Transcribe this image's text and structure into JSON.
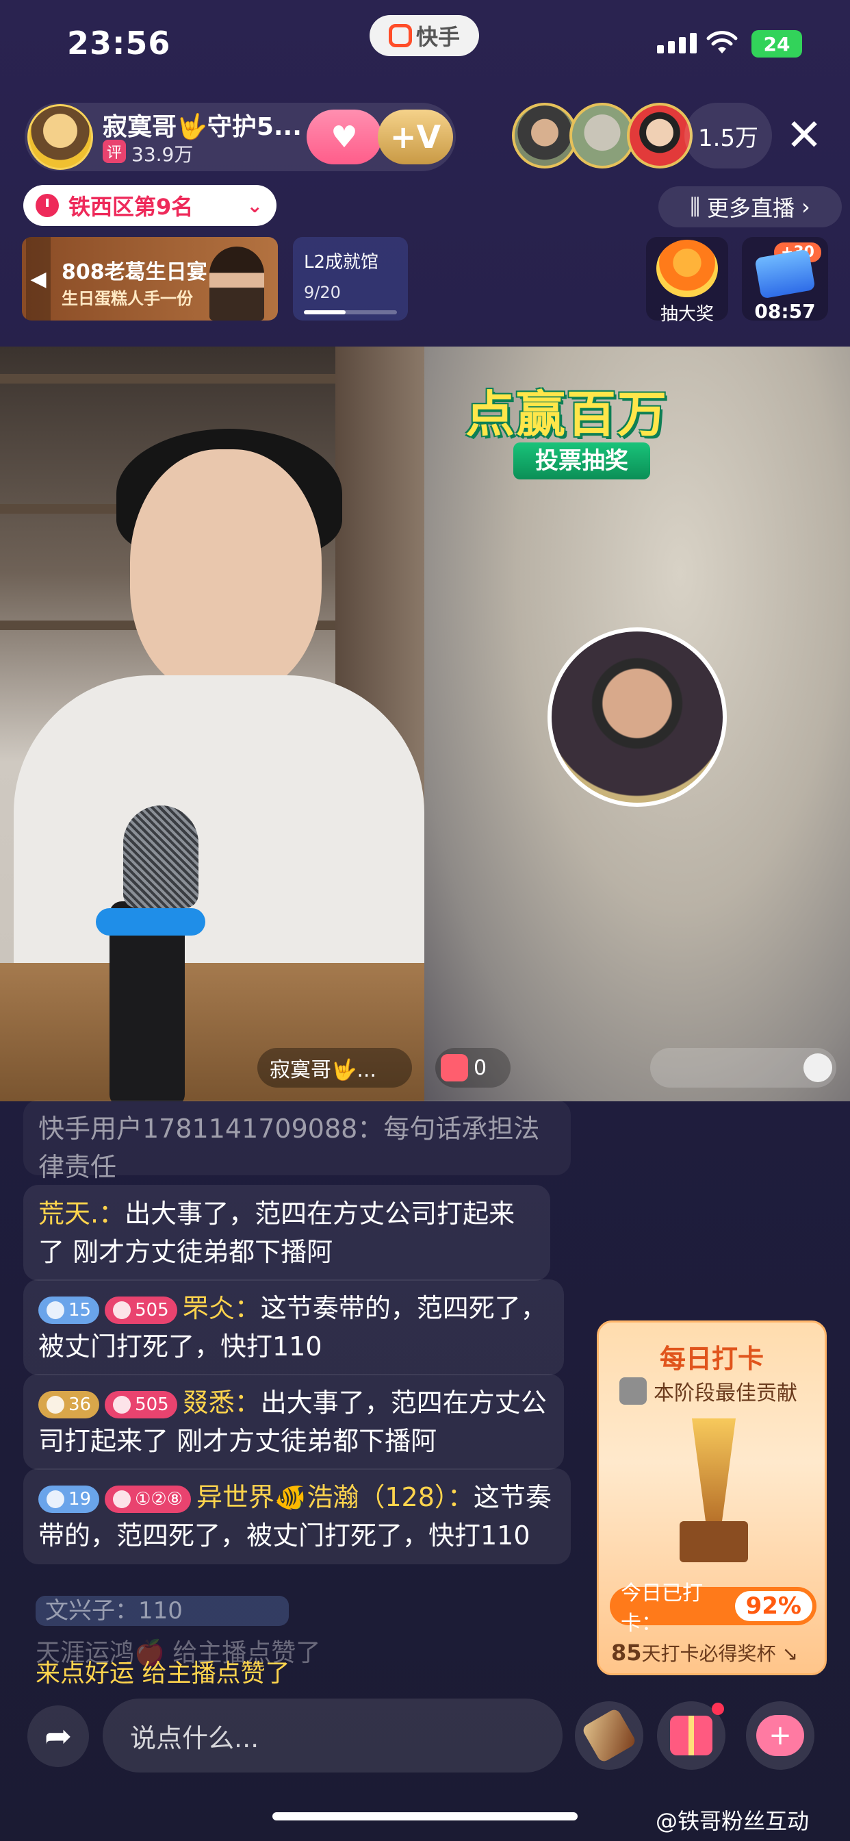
{
  "status_bar": {
    "time": "23:56",
    "app_name": "快手",
    "battery": "24"
  },
  "host": {
    "name": "寂寞哥🤟守护5...",
    "badge": "评",
    "fans": "33.9万",
    "plus_v": "+V"
  },
  "viewers": {
    "count": "1.5万",
    "close": "✕"
  },
  "rank": {
    "label": "铁西区第9名"
  },
  "more_live": {
    "label": "更多直播"
  },
  "banner": {
    "title": "808老葛生日宴",
    "subtitle": "生日蛋糕人手一份"
  },
  "achievement": {
    "title": "L2成就馆",
    "progress_text": "9/20",
    "progress": 0.45
  },
  "lucky_draw": {
    "label": "抽大奖"
  },
  "gift_timer": {
    "plus": "+30",
    "time": "08:57"
  },
  "promo": {
    "title": "点赢百万",
    "subtitle": "投票抽奖"
  },
  "video": {
    "host_tag": "寂寞哥🤟...",
    "gift_count": "0"
  },
  "comments": [
    {
      "user": "快手用户1781141709088：",
      "text": "每句话承担法律责任"
    },
    {
      "user": "荒天.：",
      "text": "出大事了，范四在方丈公司打起来了 刚才方丈徒弟都下播阿"
    },
    {
      "badge1": "15",
      "badge2": "505",
      "user": "罘仌：",
      "text": "这节奏带的，范四死了，被丈门打死了，快打110"
    },
    {
      "badge1": "36",
      "badge2": "505",
      "user": "叕悉：",
      "text": "出大事了，范四在方丈公司打起来了 刚才方丈徒弟都下播阿"
    },
    {
      "badge1": "19",
      "badge2": "①②⑧",
      "user": "异世界🐠浩瀚（128）：",
      "text": "这节奏带的，范四死了，被丈门打死了，快打110"
    }
  ],
  "fading": {
    "c1": "文兴子：110",
    "c2": "天涯运鸿🍎 给主播点赞了",
    "c3": "来点好运 给主播点赞了"
  },
  "checkin": {
    "title": "每日打卡",
    "sub": "本阶段最佳贡献",
    "today_label": "今日已打卡：",
    "percent": "92%",
    "footer_days": "85",
    "footer_text": "天打卡必得奖杯"
  },
  "bottom": {
    "placeholder": "说点什么..."
  },
  "watermark": "@铁哥粉丝互动"
}
